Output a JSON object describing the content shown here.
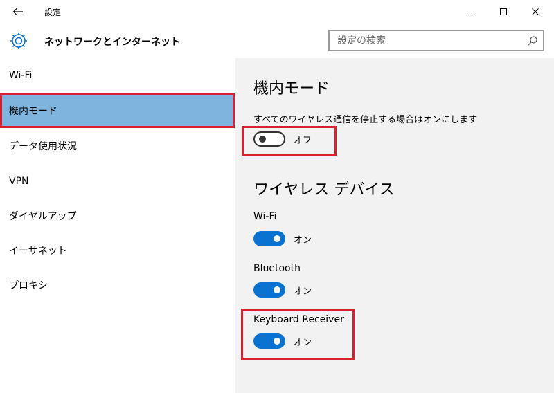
{
  "window": {
    "title": "設定"
  },
  "header": {
    "title": "ネットワークとインターネット"
  },
  "search": {
    "placeholder": "設定の検索"
  },
  "sidebar": {
    "items": [
      {
        "label": "Wi-Fi"
      },
      {
        "label": "機内モード",
        "selected": true
      },
      {
        "label": "データ使用状況"
      },
      {
        "label": "VPN"
      },
      {
        "label": "ダイヤルアップ"
      },
      {
        "label": "イーサネット"
      },
      {
        "label": "プロキシ"
      }
    ]
  },
  "airplane": {
    "title": "機内モード",
    "description": "すべてのワイヤレス通信を停止する場合はオンにします",
    "state": "オフ"
  },
  "wireless": {
    "title": "ワイヤレス デバイス",
    "devices": [
      {
        "name": "Wi-Fi",
        "state": "オン"
      },
      {
        "name": "Bluetooth",
        "state": "オン"
      },
      {
        "name": "Keyboard Receiver",
        "state": "オン"
      }
    ]
  },
  "colors": {
    "accent": "#0a73d1",
    "selection": "#7eb4de",
    "highlight": "#d9202f"
  }
}
